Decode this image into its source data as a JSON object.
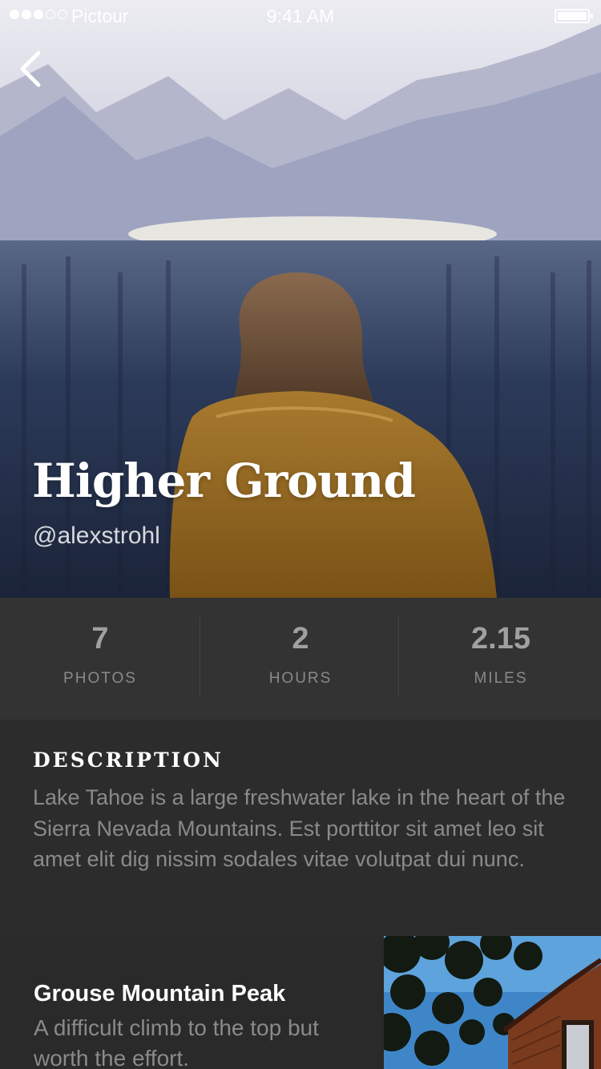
{
  "status_bar": {
    "carrier": "Pictour",
    "time": "9:41 AM",
    "signal_dots": {
      "filled": 3,
      "total": 5
    },
    "battery_level": 1.0
  },
  "nav": {
    "back_icon": "chevron-left-icon"
  },
  "hero": {
    "title": "Higher Ground",
    "handle": "@alexstrohl"
  },
  "stats": [
    {
      "value": "7",
      "label": "PHOTOS"
    },
    {
      "value": "2",
      "label": "HOURS"
    },
    {
      "value": "2.15",
      "label": "MILES"
    }
  ],
  "description": {
    "heading": "DESCRIPTION",
    "text": "Lake Tahoe is a large freshwater lake in the heart of the Sierra Nevada Mountains. Est porttitor sit amet leo sit amet elit dig nissim sodales vitae volutpat dui nunc."
  },
  "spot": {
    "title": "Grouse Mountain Peak",
    "text": "A difficult climb to the top but worth the effort."
  },
  "colors": {
    "background": "#2a2a2a",
    "stats_bg": "#333333",
    "muted_text": "#8a8a8a",
    "title_text": "#ffffff"
  }
}
